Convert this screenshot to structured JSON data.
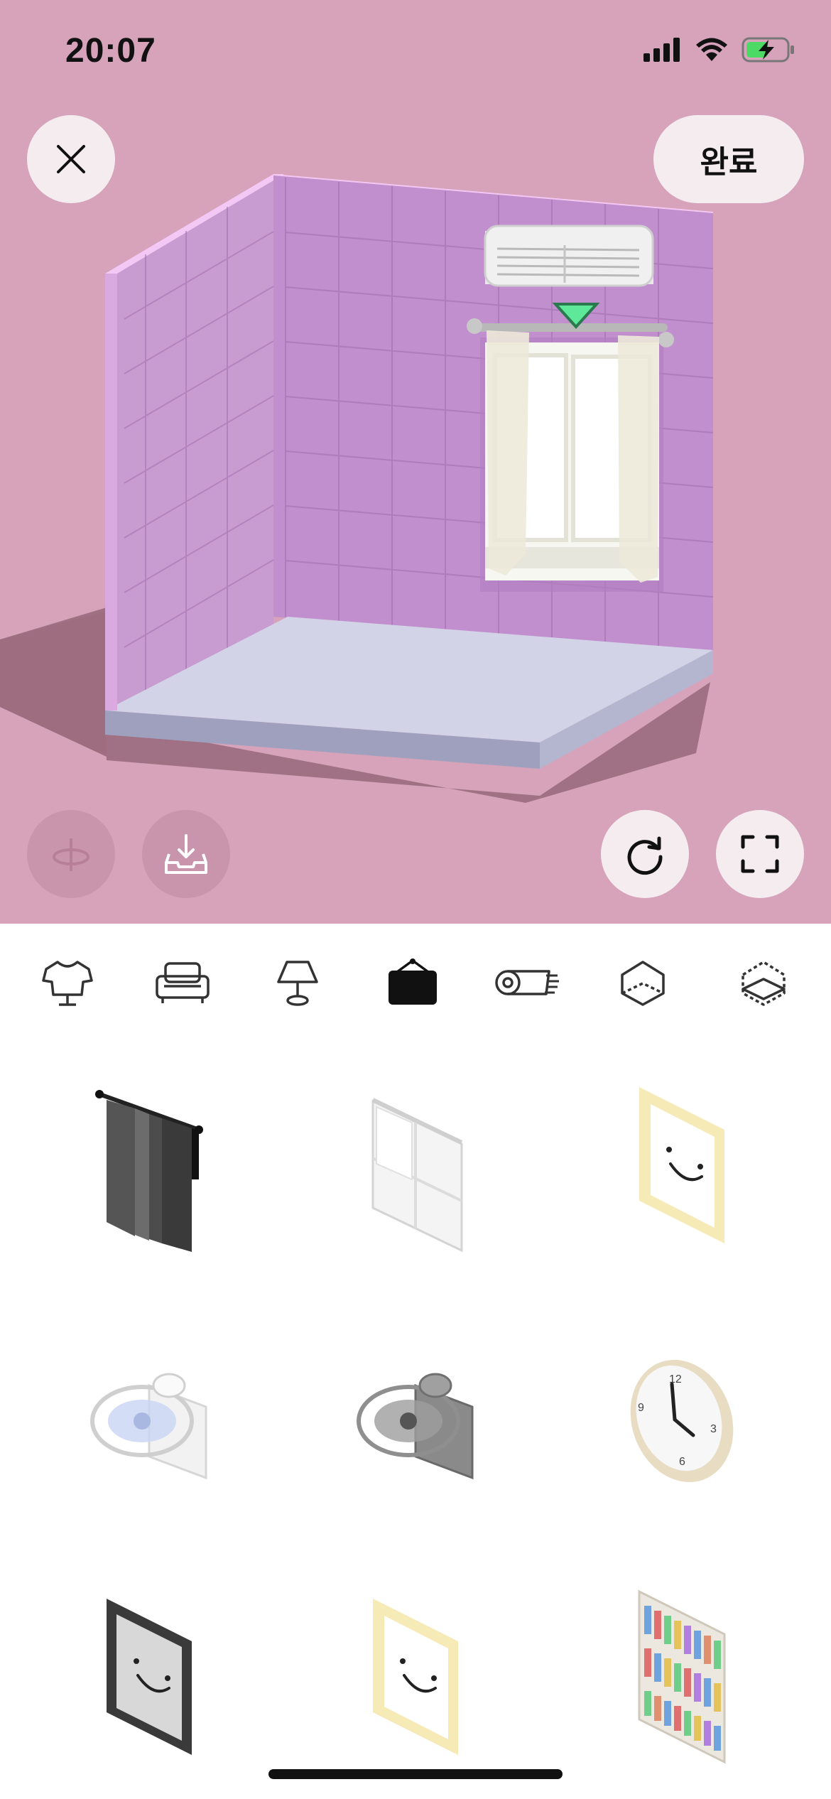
{
  "status_bar": {
    "time": "20:07",
    "icons": [
      "signal-icon",
      "wifi-icon",
      "battery-charging-icon"
    ]
  },
  "header": {
    "close_icon": "close-icon",
    "done_label": "완료"
  },
  "scene": {
    "room_items": [
      "air-conditioner",
      "window-with-curtains"
    ],
    "selection_marker": "selection-arrow-icon",
    "controls": [
      "rotate-view-icon",
      "save-to-inventory-icon",
      "reset-icon",
      "fullscreen-icon"
    ]
  },
  "category_tabs": [
    {
      "icon": "clothing-icon",
      "active": false
    },
    {
      "icon": "sofa-icon",
      "active": false
    },
    {
      "icon": "lamp-icon",
      "active": false
    },
    {
      "icon": "wall-frame-icon",
      "active": true
    },
    {
      "icon": "rug-icon",
      "active": false
    },
    {
      "icon": "wall-icon",
      "active": false
    },
    {
      "icon": "floor-icon",
      "active": false
    }
  ],
  "items": [
    {
      "name": "dark-curtain"
    },
    {
      "name": "white-curtain"
    },
    {
      "name": "cream-smile-frame"
    },
    {
      "name": "white-wall-fan"
    },
    {
      "name": "gray-wall-fan"
    },
    {
      "name": "wall-clock",
      "clock_numbers": [
        "12",
        "3",
        "6",
        "9"
      ]
    },
    {
      "name": "black-smile-frame"
    },
    {
      "name": "cream-smile-frame-2"
    },
    {
      "name": "bookshelf-wall"
    }
  ],
  "colors": {
    "scene_bg": "#d6a3bb",
    "wall": "#c796c8",
    "floor": "#d3d3e8",
    "accent_green": "#5ee89a"
  }
}
